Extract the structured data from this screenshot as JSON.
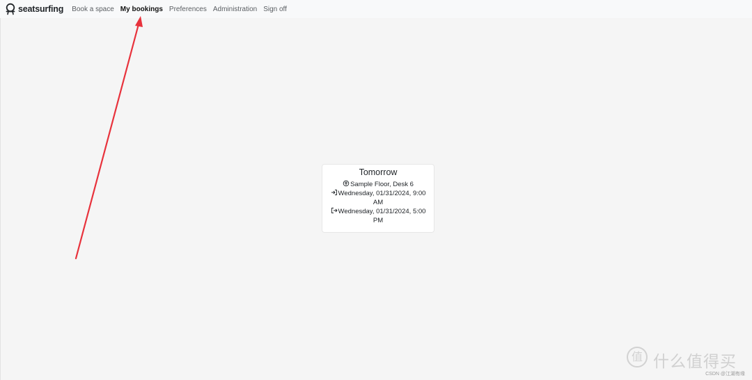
{
  "nav": {
    "brand": "seatsurfing",
    "brand_icon": "seat-location-icon",
    "links": [
      "Book a space",
      "My bookings",
      "Preferences",
      "Administration",
      "Sign off"
    ],
    "active": "My bookings"
  },
  "booking": {
    "title": "Tomorrow",
    "location": "Sample Floor, Desk 6",
    "location_icon": "location-pin-icon",
    "enter": "Wednesday, 01/31/2024, 9:00 AM",
    "enter_icon": "enter-icon",
    "leave": "Wednesday, 01/31/2024, 5:00 PM",
    "leave_icon": "exit-icon"
  },
  "annotation": {
    "arrow_color": "#e8323c"
  },
  "watermark": {
    "badge": "值",
    "text": "什么值得买",
    "small": "CSDN @江湖有缘"
  },
  "colors": {
    "background": "#f5f5f5",
    "navbar": "#f8f9fa"
  }
}
